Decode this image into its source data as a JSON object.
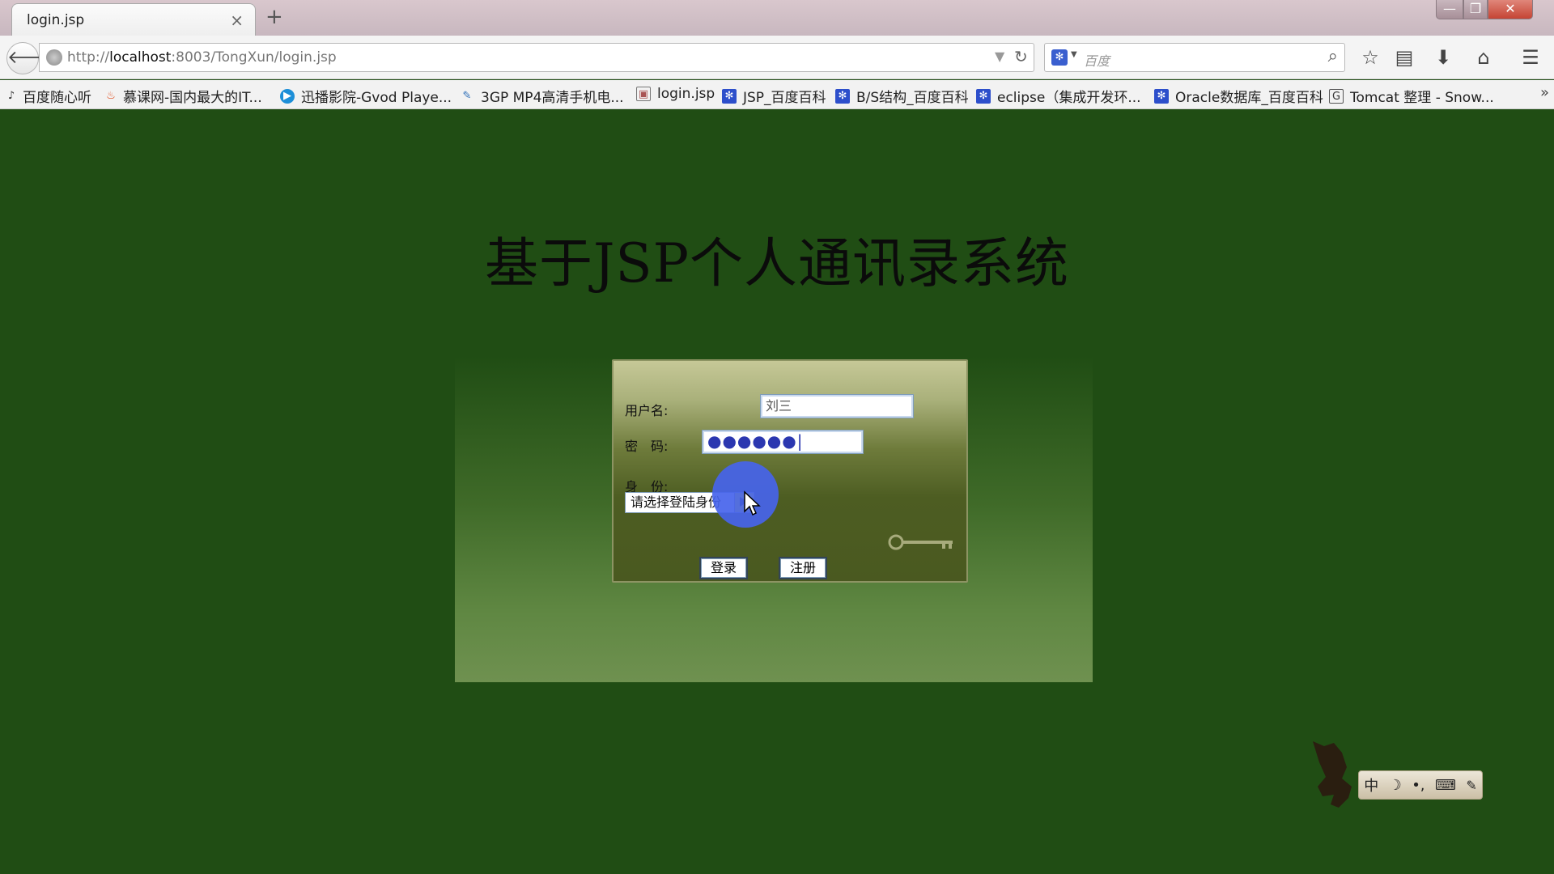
{
  "browser": {
    "tab_title": "login.jsp",
    "tab_close": "×",
    "new_tab": "+",
    "window_buttons": {
      "minimize": "—",
      "maximize": "❐",
      "close": "✕"
    },
    "url_prefix": "http://",
    "url_host": "localhost",
    "url_rest": ":8003/TongXun/login.jsp",
    "search_placeholder": "百度",
    "bookmarks": [
      "百度随心听",
      "慕课网-国内最大的IT...",
      "迅播影院-Gvod Playe...",
      "3GP MP4高清手机电...",
      "login.jsp",
      "JSP_百度百科",
      "B/S结构_百度百科",
      "eclipse（集成开发环...",
      "Oracle数据库_百度百科",
      "Tomcat 整理 - Snow..."
    ],
    "bookmarks_overflow": "»"
  },
  "page": {
    "title": "基于JSP个人通讯录系统",
    "username_label": "用户名:",
    "username_value": "刘三",
    "password_label": "密　码:",
    "password_mask": "●●●●●●|",
    "role_label": "身　份:",
    "role_selected": "请选择登陆身份",
    "login_button": "登录",
    "register_button": "注册"
  },
  "ime": {
    "mode": "中",
    "icons": [
      "moon-icon",
      "punctuation-icon",
      "keyboard-icon",
      "settings-wrench-icon"
    ],
    "punct": "•,",
    "keyboard": "⌨",
    "moon": "☽",
    "wrench": "🔧"
  },
  "colors": {
    "page_background": "#204d14",
    "click_highlight": "#4664eb",
    "select_arrow": "#f3e82a"
  }
}
